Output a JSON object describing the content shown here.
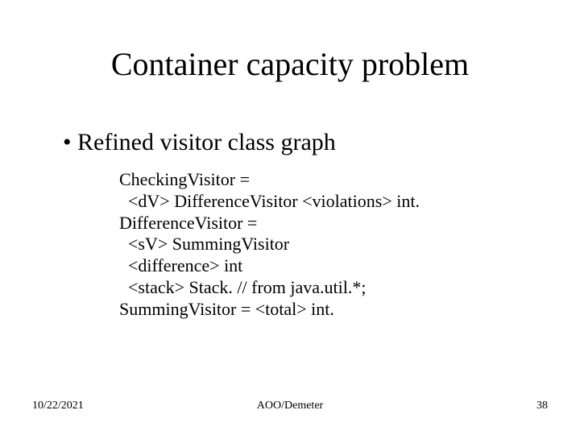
{
  "title": "Container capacity problem",
  "bullet": "Refined visitor class graph",
  "code": {
    "l1": "CheckingVisitor =",
    "l2": "  <dV> DifferenceVisitor <violations> int.",
    "l3": "DifferenceVisitor =",
    "l4": "  <sV> SummingVisitor",
    "l5": "  <difference> int",
    "l6": "  <stack> Stack. // from java.util.*;",
    "l7": "SummingVisitor = <total> int."
  },
  "footer": {
    "date": "10/22/2021",
    "center": "AOO/Demeter",
    "page": "38"
  }
}
